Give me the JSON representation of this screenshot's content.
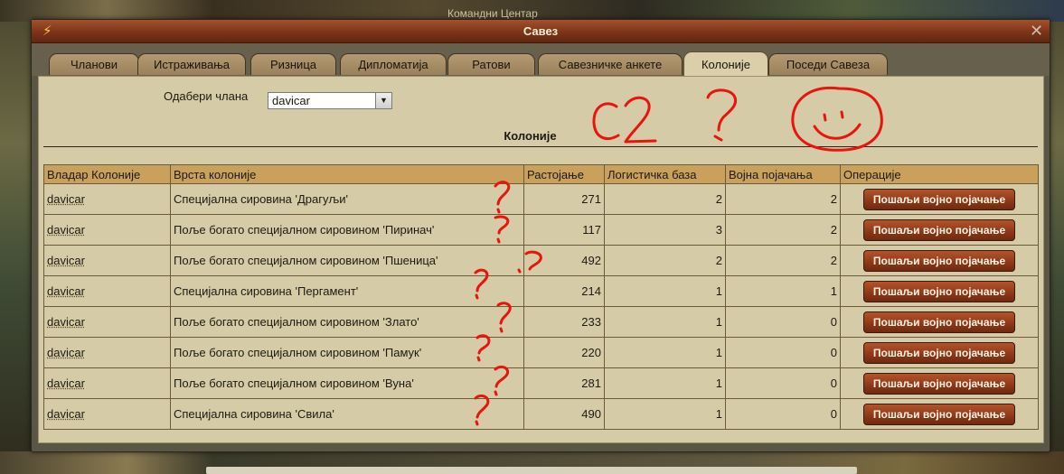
{
  "background": {
    "game_window_title": "Командни Центар"
  },
  "window": {
    "title": "Савез",
    "title_icon": "lightning-icon",
    "close_icon": "close-icon"
  },
  "tabs": [
    {
      "label": "Чланови",
      "active": false
    },
    {
      "label": "Истраживања",
      "active": false
    },
    {
      "label": "Ризница",
      "active": false
    },
    {
      "label": "Дипломатија",
      "active": false
    },
    {
      "label": "Ратови",
      "active": false
    },
    {
      "label": "Савезничке анкете",
      "active": false
    },
    {
      "label": "Колоније",
      "active": true
    },
    {
      "label": "Поседи Савеза",
      "active": false
    }
  ],
  "member_select": {
    "label": "Одабери члана",
    "value": "davicar"
  },
  "section_title": "Колоније",
  "table": {
    "headers": [
      "Владар Колоније",
      "Врста колоније",
      "Растојање",
      "Логистичка база",
      "Војна појачања",
      "Операције"
    ],
    "rows": [
      {
        "owner": "davicar",
        "type": "Специјална сировина 'Драгуљи'",
        "distance": "271",
        "logistics": "2",
        "reinforcements": "2",
        "action": "Пошаљи војно појачање"
      },
      {
        "owner": "davicar",
        "type": "Поље богато специјалном сировином 'Пиринач'",
        "distance": "117",
        "logistics": "3",
        "reinforcements": "2",
        "action": "Пошаљи војно појачање"
      },
      {
        "owner": "davicar",
        "type": "Поље богато специјалном сировином 'Пшеница'",
        "distance": "492",
        "logistics": "2",
        "reinforcements": "2",
        "action": "Пошаљи војно појачање"
      },
      {
        "owner": "davicar",
        "type": "Специјална сировина 'Пергамент'",
        "distance": "214",
        "logistics": "1",
        "reinforcements": "1",
        "action": "Пошаљи војно појачање"
      },
      {
        "owner": "davicar",
        "type": "Поље богато специјалном сировином 'Злато'",
        "distance": "233",
        "logistics": "1",
        "reinforcements": "0",
        "action": "Пошаљи војно појачање"
      },
      {
        "owner": "davicar",
        "type": "Поље богато специјалном сировином 'Памук'",
        "distance": "220",
        "logistics": "1",
        "reinforcements": "0",
        "action": "Пошаљи војно појачање"
      },
      {
        "owner": "davicar",
        "type": "Поље богато специјалном сировином 'Вуна'",
        "distance": "281",
        "logistics": "1",
        "reinforcements": "0",
        "action": "Пошаљи војно појачање"
      },
      {
        "owner": "davicar",
        "type": "Специјална сировина 'Свила'",
        "distance": "490",
        "logistics": "1",
        "reinforcements": "0",
        "action": "Пошаљи војно појачање"
      }
    ]
  },
  "annotations": {
    "text": "C2",
    "color": "#e8140e"
  }
}
